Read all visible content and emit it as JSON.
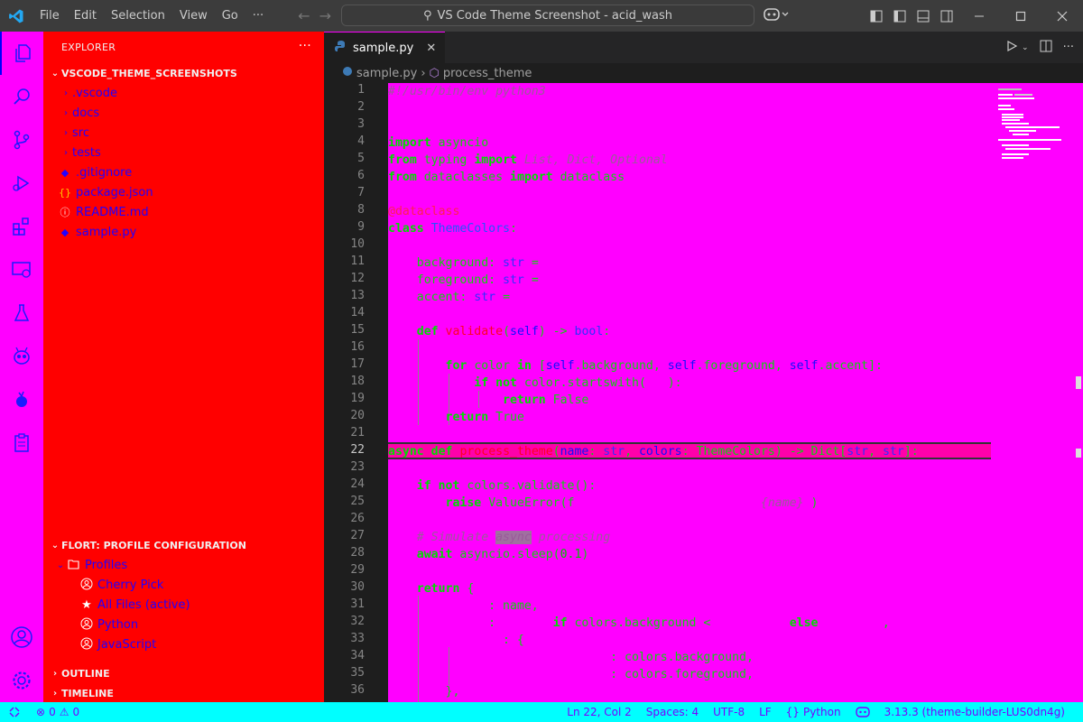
{
  "titlebar": {
    "menu": [
      "File",
      "Edit",
      "Selection",
      "View",
      "Go",
      "···"
    ],
    "search_text": "VS Code Theme Screenshot - acid_wash"
  },
  "sidebar": {
    "header": "EXPLORER",
    "more": "···",
    "workspace": "VSCODE_THEME_SCREENSHOTS",
    "folders": [
      ".vscode",
      "docs",
      "src",
      "tests"
    ],
    "files": [
      {
        "icon": "◆",
        "name": ".gitignore"
      },
      {
        "icon": "{}",
        "name": "package.json"
      },
      {
        "icon": "ⓘ",
        "name": "README.md"
      },
      {
        "icon": "◆",
        "name": "sample.py"
      }
    ],
    "profile_section": "FLORT: PROFILE CONFIGURATION",
    "profiles_label": "Profiles",
    "profiles": [
      {
        "icon": "user",
        "name": "Cherry Pick"
      },
      {
        "icon": "star",
        "name": "All Files (active)"
      },
      {
        "icon": "user",
        "name": "Python"
      },
      {
        "icon": "user",
        "name": "JavaScript"
      }
    ],
    "outline": "OUTLINE",
    "timeline": "TIMELINE"
  },
  "editor": {
    "tab_label": "sample.py",
    "breadcrumb_file": "sample.py",
    "breadcrumb_symbol": "process_theme",
    "current_line": 22,
    "line_numbers": [
      1,
      2,
      3,
      4,
      5,
      6,
      7,
      8,
      9,
      10,
      11,
      12,
      13,
      14,
      15,
      16,
      17,
      18,
      19,
      20,
      21,
      22,
      23,
      24,
      25,
      26,
      27,
      28,
      29,
      30,
      31,
      32,
      33,
      34,
      35,
      36
    ]
  },
  "statusbar": {
    "errors": "0",
    "warnings": "0",
    "position": "Ln 22, Col 2",
    "spaces": "Spaces: 4",
    "encoding": "UTF-8",
    "eol": "LF",
    "language": "Python",
    "interpreter": "3.13.3 (theme-builder-LUS0dn4g)"
  },
  "colors": {
    "background": "#ff00ff",
    "sidebar": "#ff0000",
    "statusbar": "#00ffff",
    "keyword": "#00dd00"
  }
}
